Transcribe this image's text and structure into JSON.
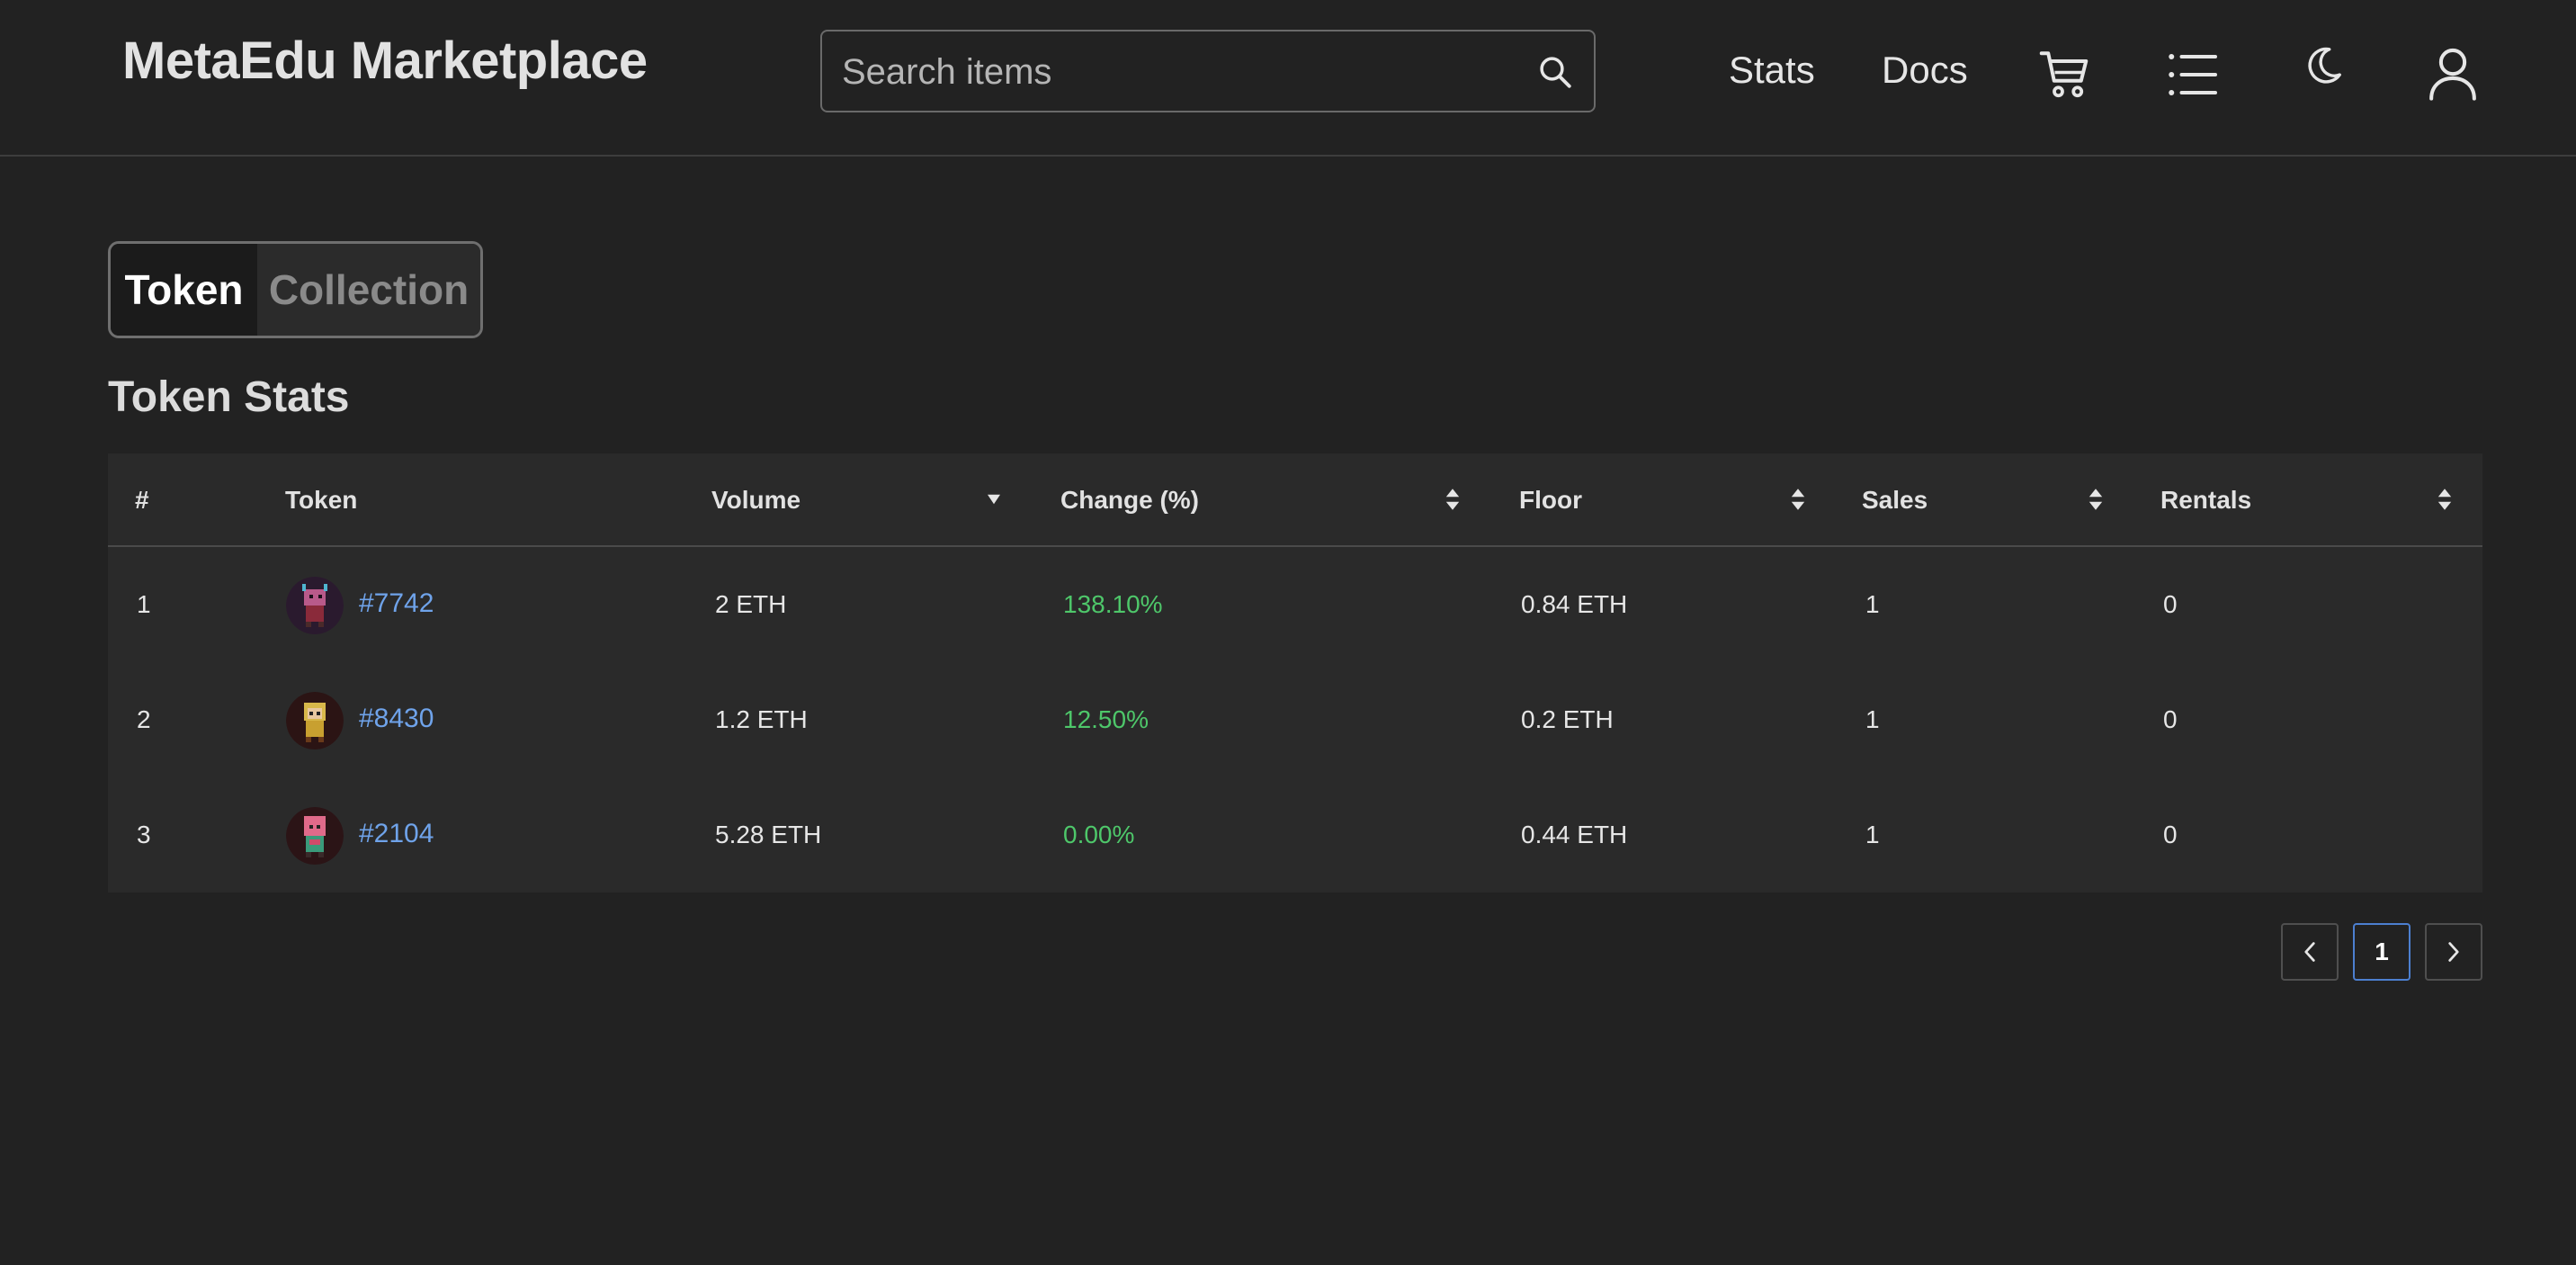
{
  "header": {
    "brand": "MetaEdu Marketplace",
    "search": {
      "placeholder": "Search items"
    },
    "nav": {
      "stats": "Stats",
      "docs": "Docs"
    },
    "icons": [
      "search-icon",
      "cart-icon",
      "list-icon",
      "moon-icon",
      "user-icon"
    ]
  },
  "toggle": {
    "token": "Token",
    "collection": "Collection",
    "selected": "Token"
  },
  "section_title": "Token Stats",
  "table": {
    "columns": [
      "#",
      "Token",
      "Volume",
      "Change (%)",
      "Floor",
      "Sales",
      "Rentals"
    ],
    "sorted_column": "Volume",
    "sort_direction": "descending",
    "rows": [
      {
        "rank": "1",
        "token": "#7742",
        "volume": "2 ETH",
        "change": "138.10%",
        "floor": "0.84 ETH",
        "sales": "1",
        "rentals": "0"
      },
      {
        "rank": "2",
        "token": "#8430",
        "volume": "1.2 ETH",
        "change": "12.50%",
        "floor": "0.2 ETH",
        "sales": "1",
        "rentals": "0"
      },
      {
        "rank": "3",
        "token": "#2104",
        "volume": "5.28 ETH",
        "change": "0.00%",
        "floor": "0.44 ETH",
        "sales": "1",
        "rentals": "0"
      }
    ]
  },
  "pagination": {
    "current_page": "1"
  },
  "colors": {
    "background": "#222222",
    "table_background": "#2a2a2a",
    "link": "#6fa3ea",
    "positive_change": "#4ec76a",
    "active_page_border": "#4c7fd0"
  }
}
